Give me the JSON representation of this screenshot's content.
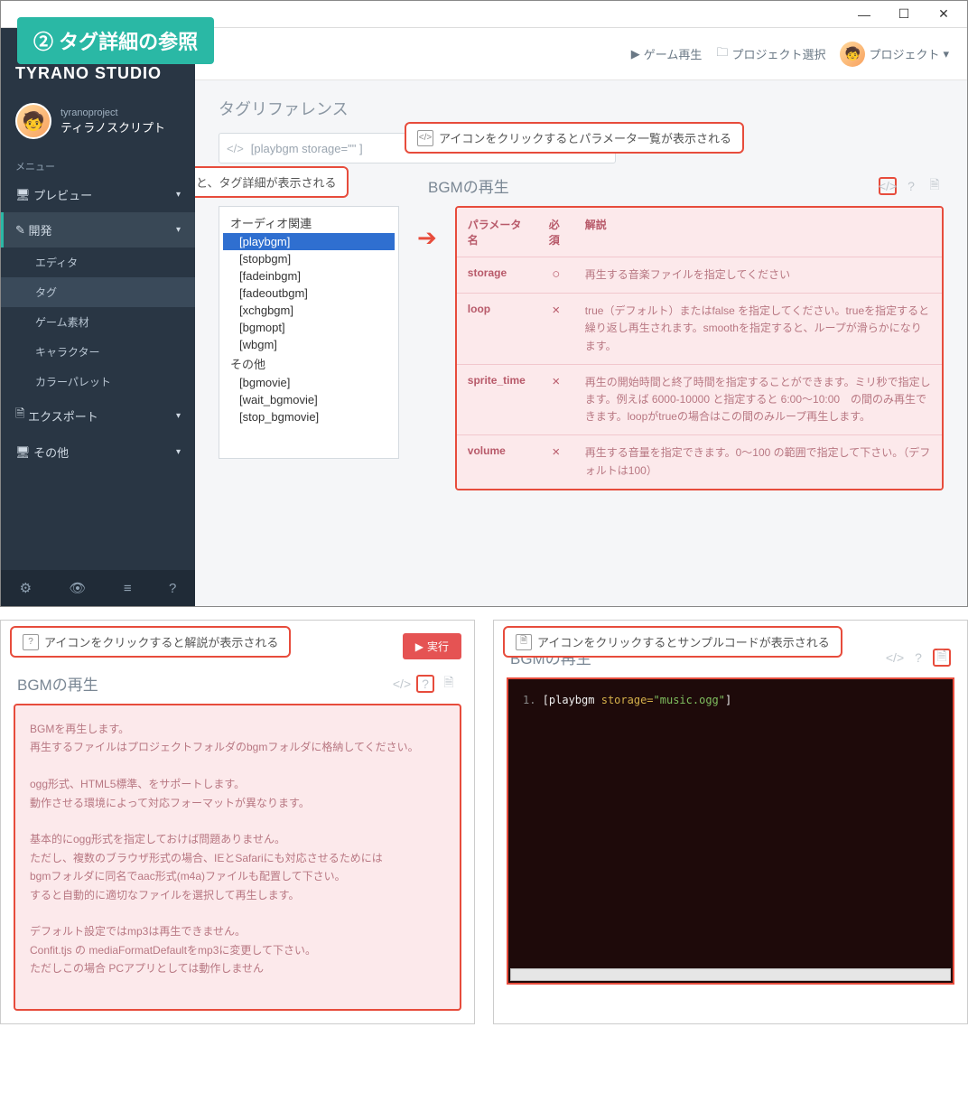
{
  "tutorial_badge": "② タグ詳細の参照",
  "app_title": "TYRANO STUDIO",
  "project": {
    "subtitle": "tyranoproject",
    "name": "ティラノスクリプト"
  },
  "menu_label": "メニュー",
  "sidebar": {
    "preview": "プレビュー",
    "dev": "開発",
    "dev_children": [
      "エディタ",
      "タグ",
      "ゲーム素材",
      "キャラクター",
      "カラーパレット"
    ],
    "export": "エクスポート",
    "other": "その他"
  },
  "topbar": {
    "play": "ゲーム再生",
    "project_select": "プロジェクト選択",
    "project": "プロジェクト"
  },
  "page_title": "タグリファレンス",
  "search_placeholder": "[playbgm storage=\"\" ]",
  "callouts": {
    "param_icon": "アイコンをクリックするとパラメータ一覧が表示される",
    "tag_click": "タグをクリックすると、タグ詳細が表示される",
    "help_icon": "アイコンをクリックすると解説が表示される",
    "sample_icon": "アイコンをクリックするとサンプルコードが表示される"
  },
  "section_title": "BGMの再生",
  "tag_list": {
    "group1": "オーディオ関連",
    "items1": [
      "[playbgm]",
      "[stopbgm]",
      "[fadeinbgm]",
      "[fadeoutbgm]",
      "[xchgbgm]",
      "[bgmopt]",
      "[wbgm]"
    ],
    "group2": "その他",
    "items2": [
      "[bgmovie]",
      "[wait_bgmovie]",
      "[stop_bgmovie]"
    ]
  },
  "param_table": {
    "h_name": "パラメータ名",
    "h_req": "必須",
    "h_desc": "解説",
    "rows": [
      {
        "name": "storage",
        "req": "○",
        "desc": "再生する音楽ファイルを指定してください"
      },
      {
        "name": "loop",
        "req": "×",
        "desc": "true（デフォルト）またはfalse を指定してください。trueを指定すると繰り返し再生されます。smoothを指定すると、ループが滑らかになります。"
      },
      {
        "name": "sprite_time",
        "req": "×",
        "desc": "再生の開始時間と終了時間を指定することができます。ミリ秒で指定します。例えば 6000-10000 と指定すると 6:00〜10:00　の間のみ再生できます。loopがtrueの場合はこの間のみループ再生します。"
      },
      {
        "name": "volume",
        "req": "×",
        "desc": "再生する音量を指定できます。0〜100 の範囲で指定して下さい。（デフォルトは100）"
      }
    ]
  },
  "run_button": "実行",
  "doc_text": "BGMを再生します。\n再生するファイルはプロジェクトフォルダのbgmフォルダに格納してください。\n\nogg形式、HTML5標準、をサポートします。\n動作させる環境によって対応フォーマットが異なります。\n\n基本的にogg形式を指定しておけば問題ありません。\nただし、複数のブラウザ形式の場合、IEとSafariにも対応させるためには\nbgmフォルダに同名でaac形式(m4a)ファイルも配置して下さい。\nすると自動的に適切なファイルを選択して再生します。\n\nデフォルト設定ではmp3は再生できません。\nConfit.tjs の mediaFormatDefaultをmp3に変更して下さい。\nただしこの場合 PCアプリとしては動作しません",
  "code": {
    "line_no": "1.",
    "tag_open": "[playbgm ",
    "attr": "storage=",
    "value": "\"music.ogg\"",
    "tag_close": "]"
  }
}
